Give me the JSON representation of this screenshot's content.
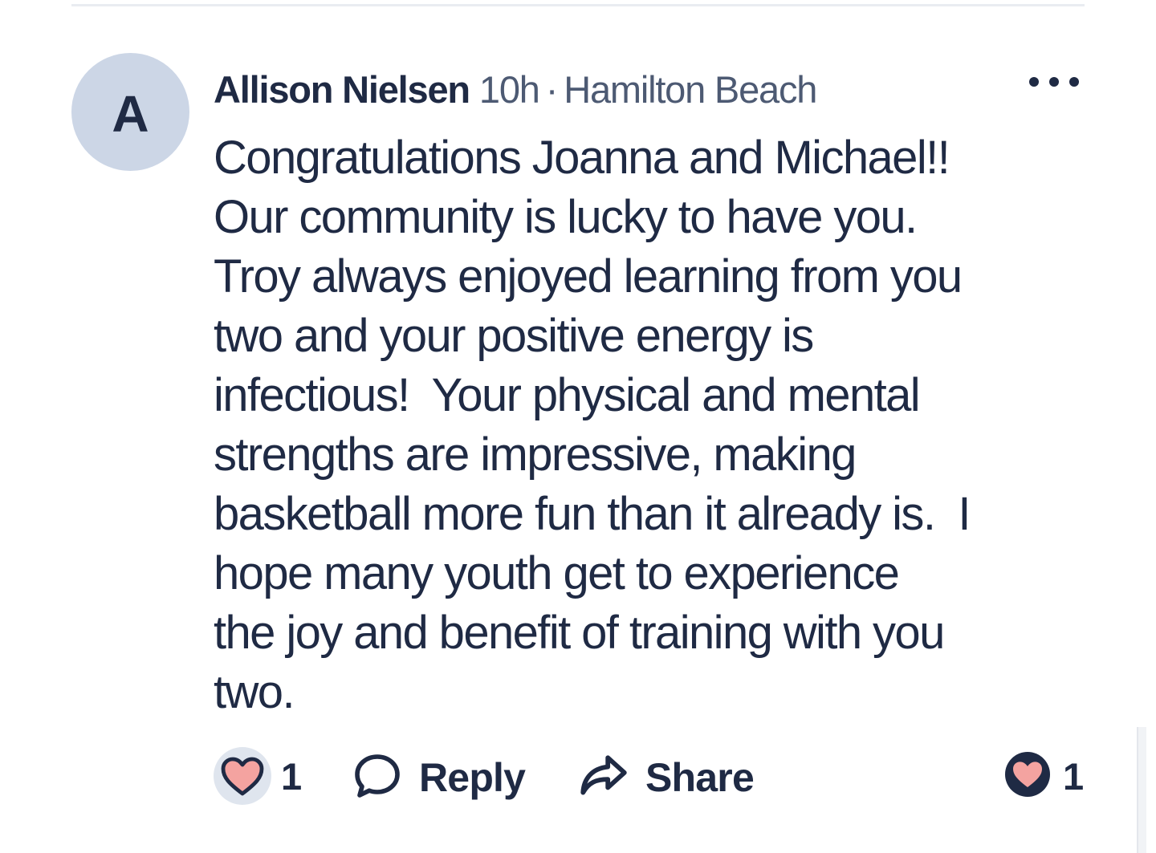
{
  "comment": {
    "avatar_letter": "A",
    "author": "Allison Nielsen",
    "time": "10h",
    "separator": "·",
    "location": "Hamilton Beach",
    "body_lines": [
      "Congratulations Joanna and Michael!!",
      "Our community is lucky to have you.",
      "Troy always enjoyed learning from you",
      "two and your positive energy is",
      "infectious!  Your physical and mental",
      "strengths are impressive, making",
      "basketball more fun than it already is.  I",
      "hope many youth get to experience",
      "the joy and benefit of training with you",
      "two."
    ]
  },
  "actions": {
    "reaction_count": "1",
    "reply_label": "Reply",
    "share_label": "Share",
    "total_reactions": "1"
  },
  "icons": {
    "more": "more-horizontal-icon",
    "heart": "heart-icon",
    "reply": "speech-bubble-icon",
    "share": "share-arrow-icon"
  },
  "colors": {
    "text": "#1f2a44",
    "meta": "#4d5a73",
    "avatar_bg": "#ccd6e6",
    "heart_fill": "#f4a3a0",
    "ring_bg": "#dfe5ee"
  }
}
